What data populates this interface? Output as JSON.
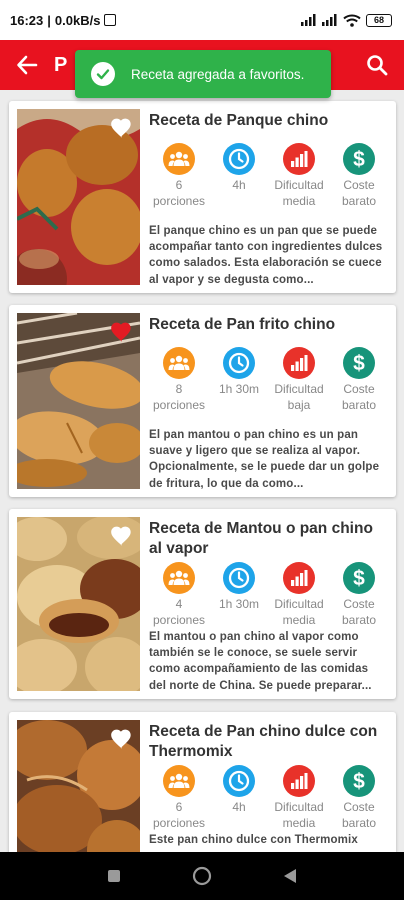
{
  "status_bar": {
    "time": "16:23",
    "speed": "0.0kB/s",
    "battery": "68"
  },
  "app_bar": {
    "title": "P"
  },
  "toast": {
    "message": "Receta agregada a favoritos."
  },
  "colors": {
    "primary": "#e8121f",
    "toast": "#2fb24a",
    "portions": "#f7941d",
    "time": "#1ea4e9",
    "difficulty": "#e8322a",
    "cost": "#17947a"
  },
  "recipes": [
    {
      "title": "Receta de Panque chino",
      "favorite": false,
      "portions_value": "6",
      "portions_label": "porciones",
      "time": "4h",
      "difficulty_label": "Dificultad",
      "difficulty_value": "media",
      "cost_label": "Coste",
      "cost_value": "barato",
      "description": "El panque chino es un pan que se puede acompañar tanto con ingredientes dulces como salados. Esta elaboración se cuece al vapor y se degusta como..."
    },
    {
      "title": "Receta de Pan frito chino",
      "favorite": true,
      "portions_value": "8",
      "portions_label": "porciones",
      "time": "1h 30m",
      "difficulty_label": "Dificultad",
      "difficulty_value": "baja",
      "cost_label": "Coste",
      "cost_value": "barato",
      "description": "El pan mantou o pan chino es un pan suave y ligero que se realiza al vapor. Opcionalmente, se le puede dar un golpe de fritura, lo que da como..."
    },
    {
      "title": "Receta de Mantou o pan chino al vapor",
      "favorite": false,
      "portions_value": "4",
      "portions_label": "porciones",
      "time": "1h 30m",
      "difficulty_label": "Dificultad",
      "difficulty_value": "media",
      "cost_label": "Coste",
      "cost_value": "barato",
      "description": "El mantou o pan chino al vapor como también se le conoce, se suele servir como acompañamiento de las comidas del norte de China. Se puede preparar..."
    },
    {
      "title": "Receta de Pan chino dulce con Thermomix",
      "favorite": false,
      "portions_value": "6",
      "portions_label": "porciones",
      "time": "4h",
      "difficulty_label": "Dificultad",
      "difficulty_value": "media",
      "cost_label": "Coste",
      "cost_value": "barato",
      "description": "Este pan chino dulce con Thermomix"
    }
  ],
  "icons": {
    "portions": "people-icon",
    "time": "clock-icon",
    "difficulty": "bar-chart-icon",
    "cost": "dollar-icon",
    "favorite": "heart-icon"
  }
}
